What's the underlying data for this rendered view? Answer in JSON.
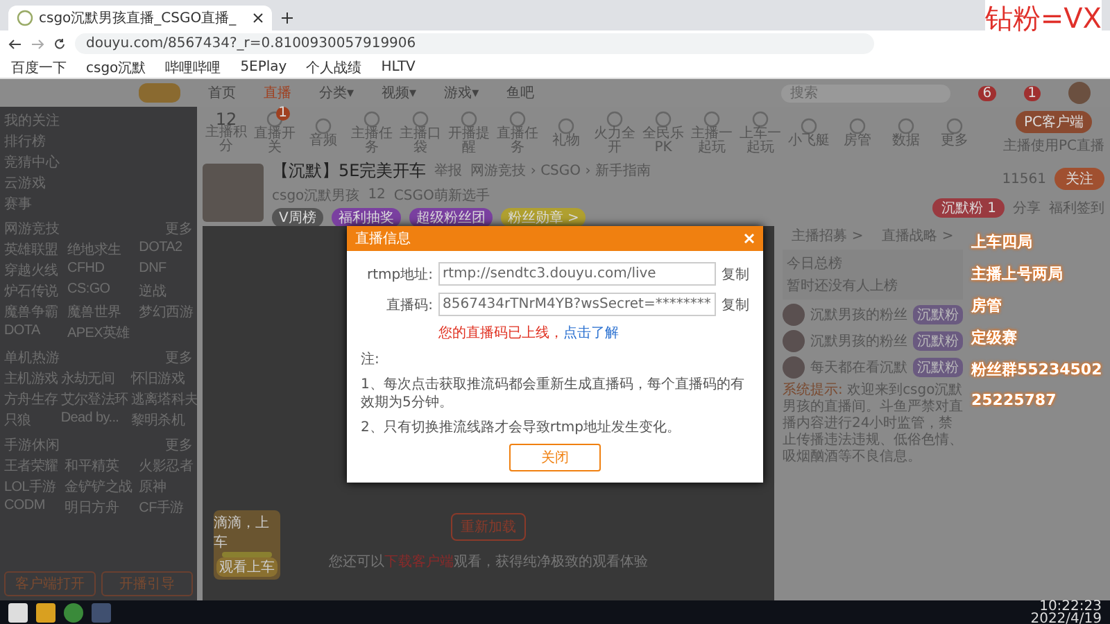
{
  "browser": {
    "tab_title": "csgo沉默男孩直播_CSGO直播_",
    "url": "douyu.com/8567434?_r=0.8100930057919906",
    "bookmarks": [
      "百度一下",
      "csgo沉默",
      "哔哩哔哩",
      "5EPlay",
      "个人战绩",
      "HLTV"
    ]
  },
  "site_nav": {
    "items": [
      {
        "label": "首页",
        "selected": false
      },
      {
        "label": "直播",
        "selected": true
      },
      {
        "label": "分类▾",
        "selected": false
      },
      {
        "label": "视频▾",
        "selected": false
      },
      {
        "label": "游戏▾",
        "selected": false
      },
      {
        "label": "鱼吧",
        "selected": false
      }
    ],
    "search_placeholder": "搜索",
    "notice_counts": [
      "6",
      "1"
    ]
  },
  "sidebar": {
    "items": [
      "我的关注",
      "排行榜",
      "竞猜中心",
      "云游戏",
      "赛事"
    ],
    "sections": [
      {
        "title": "网游竞技",
        "more": "更多",
        "games": [
          "英雄联盟",
          "绝地求生",
          "DOTA2",
          "穿越火线",
          "CFHD",
          "DNF",
          "炉石传说",
          "CS:GO",
          "逆战",
          "魔兽争霸",
          "魔兽世界",
          "梦幻西游",
          "DOTA",
          "APEX英雄"
        ]
      },
      {
        "title": "单机热游",
        "more": "更多",
        "games": [
          "主机游戏",
          "永劫无间",
          "怀旧游戏",
          "方舟生存",
          "艾尔登法环",
          "逃离塔科夫",
          "只狼",
          "Dead by...",
          "黎明杀机"
        ]
      },
      {
        "title": "手游休闲",
        "more": "更多",
        "games": [
          "王者荣耀",
          "和平精英",
          "火影忍者",
          "LOL手游",
          "金铲铲之战",
          "原神",
          "CODM",
          "明日方舟",
          "CF手游"
        ]
      }
    ],
    "buttons": [
      "客户端打开",
      "开播引导"
    ]
  },
  "toolbar": {
    "score": "12",
    "score_label": "主播积分",
    "items": [
      "直播开关",
      "音频",
      "主播任务",
      "主播口袋",
      "开播提醒",
      "直播任务",
      "礼物",
      "火力全开",
      "全民乐PK",
      "主播一起玩",
      "上车一起玩",
      "小飞艇",
      "房管",
      "数据",
      "更多"
    ],
    "badge": "1",
    "client_button": "PC客户端",
    "client_note": "主播使用PC直播"
  },
  "streamer": {
    "title": "【沉默】5E完美开车",
    "report": "举报",
    "category": "网游竞技 › CSGO › 新手指南",
    "name": "csgo沉默男孩",
    "hot": "12",
    "level_tag": "CSGO萌新选手",
    "tags": [
      "V周榜",
      "福利抽奖",
      "超级粉丝团",
      "粉丝勋章 >"
    ],
    "fans": "11561",
    "follow": "关注",
    "fanclub": "1",
    "fanclub_label": "沉默粉",
    "share": "分享",
    "sign": "福利签到"
  },
  "player": {
    "reload": "重新加载",
    "hint": "您还可以",
    "hint_link": "下载客户端",
    "hint_after": "观看，获得纯净极致的观看体验",
    "promo_title": "滴滴，上车",
    "promo_button": "观看上车"
  },
  "right_panel": {
    "tabs": [
      "主播招募 >",
      "直播战略 >"
    ],
    "rank_title": "今日总榜",
    "rank_note": "暂时还没有人上榜",
    "users": [
      {
        "name": "沉默男孩的粉丝",
        "badge": "沉默粉"
      },
      {
        "name": "沉默男孩的粉丝",
        "badge": "沉默粉"
      },
      {
        "name": "每天都在看沉默",
        "badge": "沉默粉"
      }
    ],
    "system_label": "系统提示:",
    "system_text": "欢迎来到csgo沉默男孩的直播间。斗鱼严禁对直播内容进行24小时监管，禁止传播违法违规、低俗色情、吸烟酗酒等不良信息。"
  },
  "modal": {
    "title": "直播信息",
    "rows": [
      {
        "label": "rtmp地址:",
        "value": "rtmp://sendtc3.douyu.com/live",
        "action": "复制"
      },
      {
        "label": "直播码:",
        "value": "8567434rTNrM4YB?wsSecret=********",
        "action": "复制"
      }
    ],
    "warning": "您的直播码已上线，",
    "warning_link": "点击了解",
    "note_title": "注:",
    "notes": [
      "1、每次点击获取推流码都会重新生成直播码，每个直播码的有效期为5分钟。",
      "2、只有切换推流线路才会导致rtmp地址发生变化。"
    ],
    "close": "关闭"
  },
  "stream_overlay": {
    "corner": "钻粉=VX",
    "lines": [
      "上车四局",
      "主播上号两局",
      "房管",
      "定级赛",
      "粉丝群55234502",
      "25225787"
    ]
  },
  "taskbar": {
    "time": "10:22:23",
    "date": "2022/4/19"
  }
}
